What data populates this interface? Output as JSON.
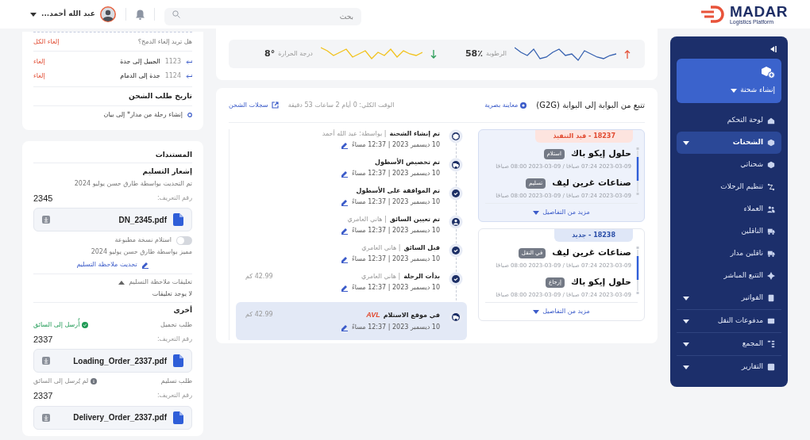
{
  "header": {
    "brand": {
      "name": "MADAR",
      "tagline": "Logistics Platform"
    },
    "search": {
      "placeholder": "بحث"
    },
    "user": {
      "name": "عبد الله أحمد..."
    }
  },
  "sidebar": {
    "create_button": {
      "label": "إنشاء شحنة"
    },
    "items": [
      {
        "label": "لوحة التحكم",
        "selected": false,
        "expandable": false
      },
      {
        "label": "الشحنات",
        "selected": true,
        "expandable": true
      },
      {
        "label": "شحناتي",
        "selected": false,
        "expandable": false
      },
      {
        "label": "تنظيم الرحلات",
        "selected": false,
        "expandable": false
      },
      {
        "label": "العملاء",
        "selected": false,
        "expandable": false
      },
      {
        "label": "الناقلين",
        "selected": false,
        "expandable": false
      },
      {
        "label": "ناقلين مدار",
        "selected": false,
        "expandable": false
      },
      {
        "label": "التتبع المباشر",
        "selected": false,
        "expandable": false
      },
      {
        "label": "الفواتير",
        "selected": false,
        "expandable": true
      },
      {
        "label": "مدفوعات النقل",
        "selected": false,
        "expandable": true
      },
      {
        "label": "المجمع",
        "selected": false,
        "expandable": true
      },
      {
        "label": "التقارير",
        "selected": false,
        "expandable": true
      }
    ]
  },
  "sensors": [
    {
      "kind": "humidity",
      "label": "الرطوبة",
      "value": "58٪",
      "rising": true
    },
    {
      "kind": "temperature",
      "label": "درجة الحرارة",
      "value": "8°",
      "rising": false
    }
  ],
  "tracking": {
    "title": "تتبع من البوابة إلى البوابة (G2G)",
    "visual_link": "معاينة بصرية",
    "total_time": "الوقت الكلي: 0 أيام 2 ساعات 53 دقيقة",
    "logs_link": "سجلات الشحن",
    "shipments": [
      {
        "badge": "18237 - قيد التنفيذ",
        "color": "#e14a30",
        "selected": true,
        "stops": [
          {
            "name": "حلول إيكو باك",
            "tag": "استلام",
            "times": "2023-03-09 07:24 صباحًا / 09-03-2023 08:00 صباحًا"
          },
          {
            "name": "صناعات غرين ليف",
            "tag": "تسليم",
            "times": "2023-03-09 07:24 صباحًا / 09-03-2023 08:00 صباحًا"
          }
        ],
        "more": "مزيد من التفاصيل"
      },
      {
        "badge": "18238 - جديد",
        "color": "#2a4ea8",
        "selected": false,
        "stops": [
          {
            "name": "صناعات غرين ليف",
            "tag": "في النقل",
            "times": "2023-03-09 07:24 صباحًا / 09-03-2023 08:00 صباحًا"
          },
          {
            "name": "حلول إيكو باك",
            "tag": "إرجاع",
            "times": "2023-03-09 07:24 صباحًا / 09-03-2023 08:00 صباحًا"
          }
        ],
        "more": "مزيد من التفاصيل"
      }
    ],
    "events": [
      {
        "kind": "box",
        "title": "تم إنشاء الشحنة",
        "by": "| بواسطة: عبد الله أحمد",
        "date": "10 ديسمبر 2023 | 12:37 مساءً",
        "selected": false
      },
      {
        "kind": "truck",
        "title": "تم تخصيص الأسطول",
        "date": "10 ديسمبر 2023 | 12:37 مساءً",
        "selected": false
      },
      {
        "kind": "check",
        "title": "تم الموافقة على الأسطول",
        "date": "10 ديسمبر 2023 | 12:37 مساءً",
        "selected": false
      },
      {
        "kind": "person",
        "title": "تم تعيين السائق",
        "by": "| هاني العامري",
        "date": "10 ديسمبر 2023 | 12:37 مساءً",
        "selected": false
      },
      {
        "kind": "check",
        "title": "قبل السائق",
        "by": "| هاني العامري",
        "date": "10 ديسمبر 2023 | 12:37 مساءً",
        "selected": false
      },
      {
        "kind": "check",
        "title": "بدأت الرحلة",
        "by": "| هاني العامري",
        "date": "10 ديسمبر 2023 | 12:37 مساءً",
        "distance": "42.99 كم",
        "selected": false
      },
      {
        "kind": "truck",
        "title": "في موقع الاستلام",
        "tag": "AVL",
        "date": "10 ديسمبر 2023 | 12:37 مساءً",
        "distance": "42.99 كم",
        "selected": true
      }
    ]
  },
  "merge_panel": {
    "question": "هل تريد إلغاء الدمج؟",
    "cancel_all": "إلغاء الكل",
    "trips": [
      {
        "id": "1123",
        "route": "الجبيل إلى جدة",
        "action": "إلغاء"
      },
      {
        "id": "1124",
        "route": "جدة إلى الدمام",
        "action": "إلغاء"
      }
    ],
    "history_title": "تاريخ طلب الشحن",
    "history": [
      "إنشاء رحلة من مدار* إلى بيان"
    ]
  },
  "documents": {
    "title": "المستندات",
    "delivery_notice": {
      "title": "إشعار التسليم",
      "updated": "تم التحديث بواسطة طارق حسن يوليو 2024",
      "id_label": "رقم التعريف:",
      "id": "2345",
      "file": "DN_2345.pdf",
      "toggle_label": "استلام نسخة مطبوعة",
      "toggle_on": false,
      "marked": "مميز بواسطة طارق حسن يوليو 2024",
      "update_link": "تحديث ملاحظة التسليم"
    },
    "comments": {
      "label": "تعليقات ملاحظة التسليم",
      "expanded": true,
      "empty": "لا يوجد تعليقات"
    },
    "other": {
      "title": "أخرى",
      "items": [
        {
          "type": "طلب تحميل",
          "status": "أُرسل إلى السائق",
          "sent": true,
          "id_label": "رقم التعريف:",
          "id": "2337",
          "file": "Loading_Order_2337.pdf"
        },
        {
          "type": "طلب تسليم",
          "status": "لم يُرسل إلى السائق",
          "sent": false,
          "id_label": "رقم التعريف:",
          "id": "2337",
          "file": "Delivery_Order_2337.pdf"
        }
      ]
    }
  }
}
